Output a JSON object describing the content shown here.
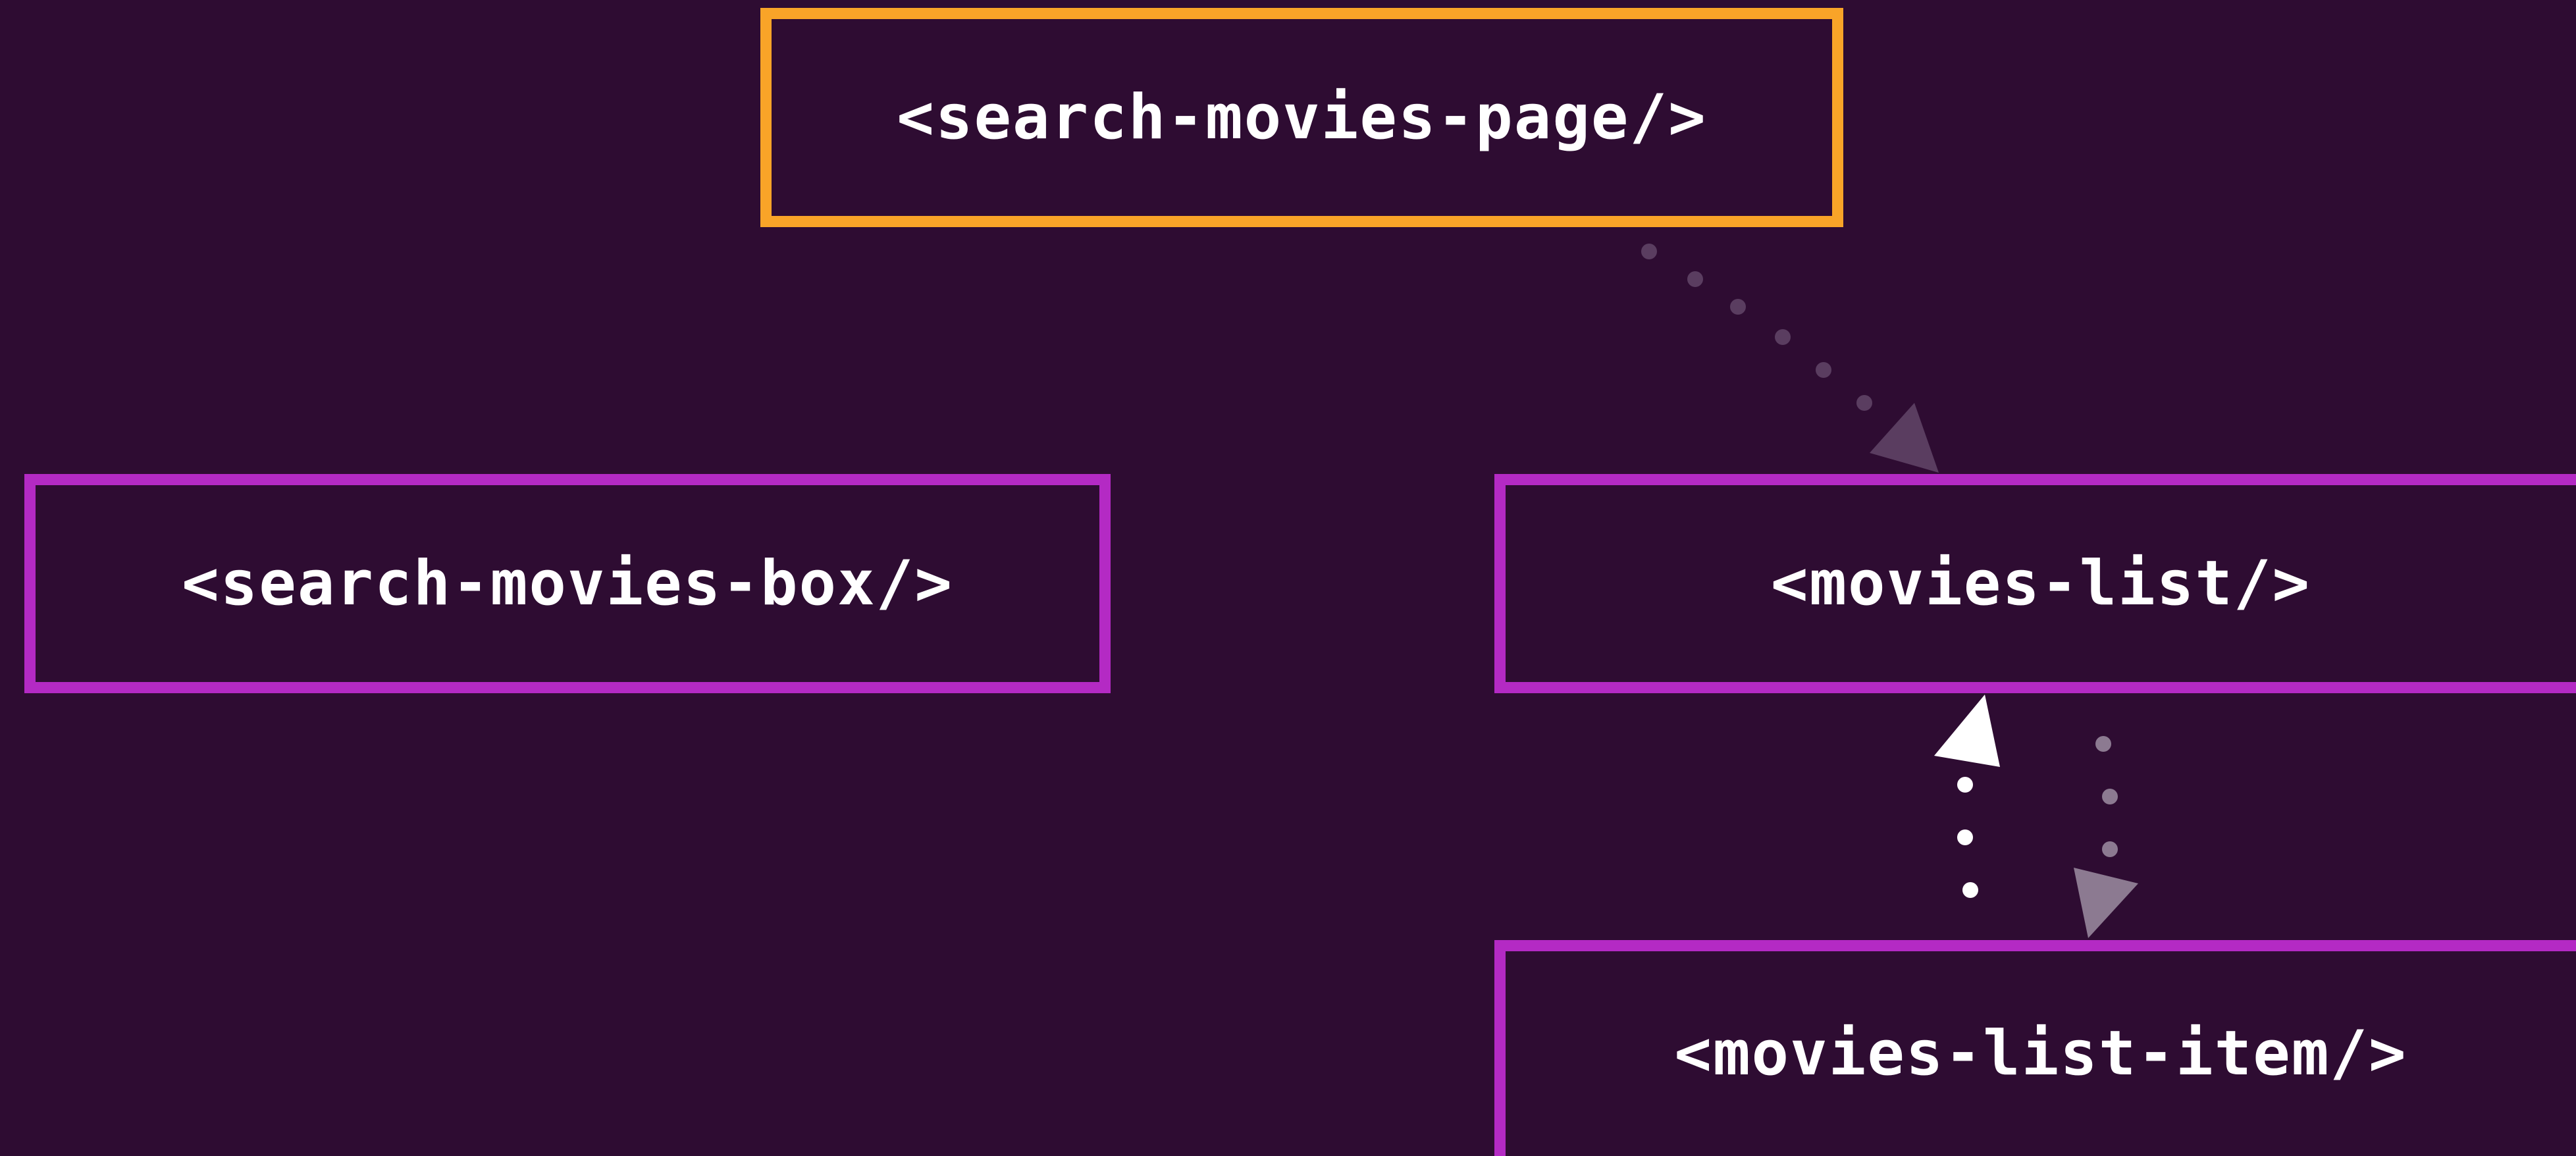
{
  "colors": {
    "background": "#2e0c32",
    "root_border": "#f9a428",
    "child_border": "#b42ac4",
    "text": "#ffffff",
    "edge_dim": "#5a3d60",
    "edge_mid": "#8c7a91",
    "edge_bright": "#ffffff"
  },
  "nodes": {
    "page": {
      "label": "<search-movies-page/>"
    },
    "box": {
      "label": "<search-movies-box/>"
    },
    "list": {
      "label": "<movies-list/>"
    },
    "item": {
      "label": "<movies-list-item/>"
    }
  },
  "edges": [
    {
      "from": "page",
      "to": "list",
      "style": "dotted"
    },
    {
      "from": "list",
      "to": "item",
      "style": "dotted"
    },
    {
      "from": "item",
      "to": "list",
      "style": "dotted"
    }
  ]
}
